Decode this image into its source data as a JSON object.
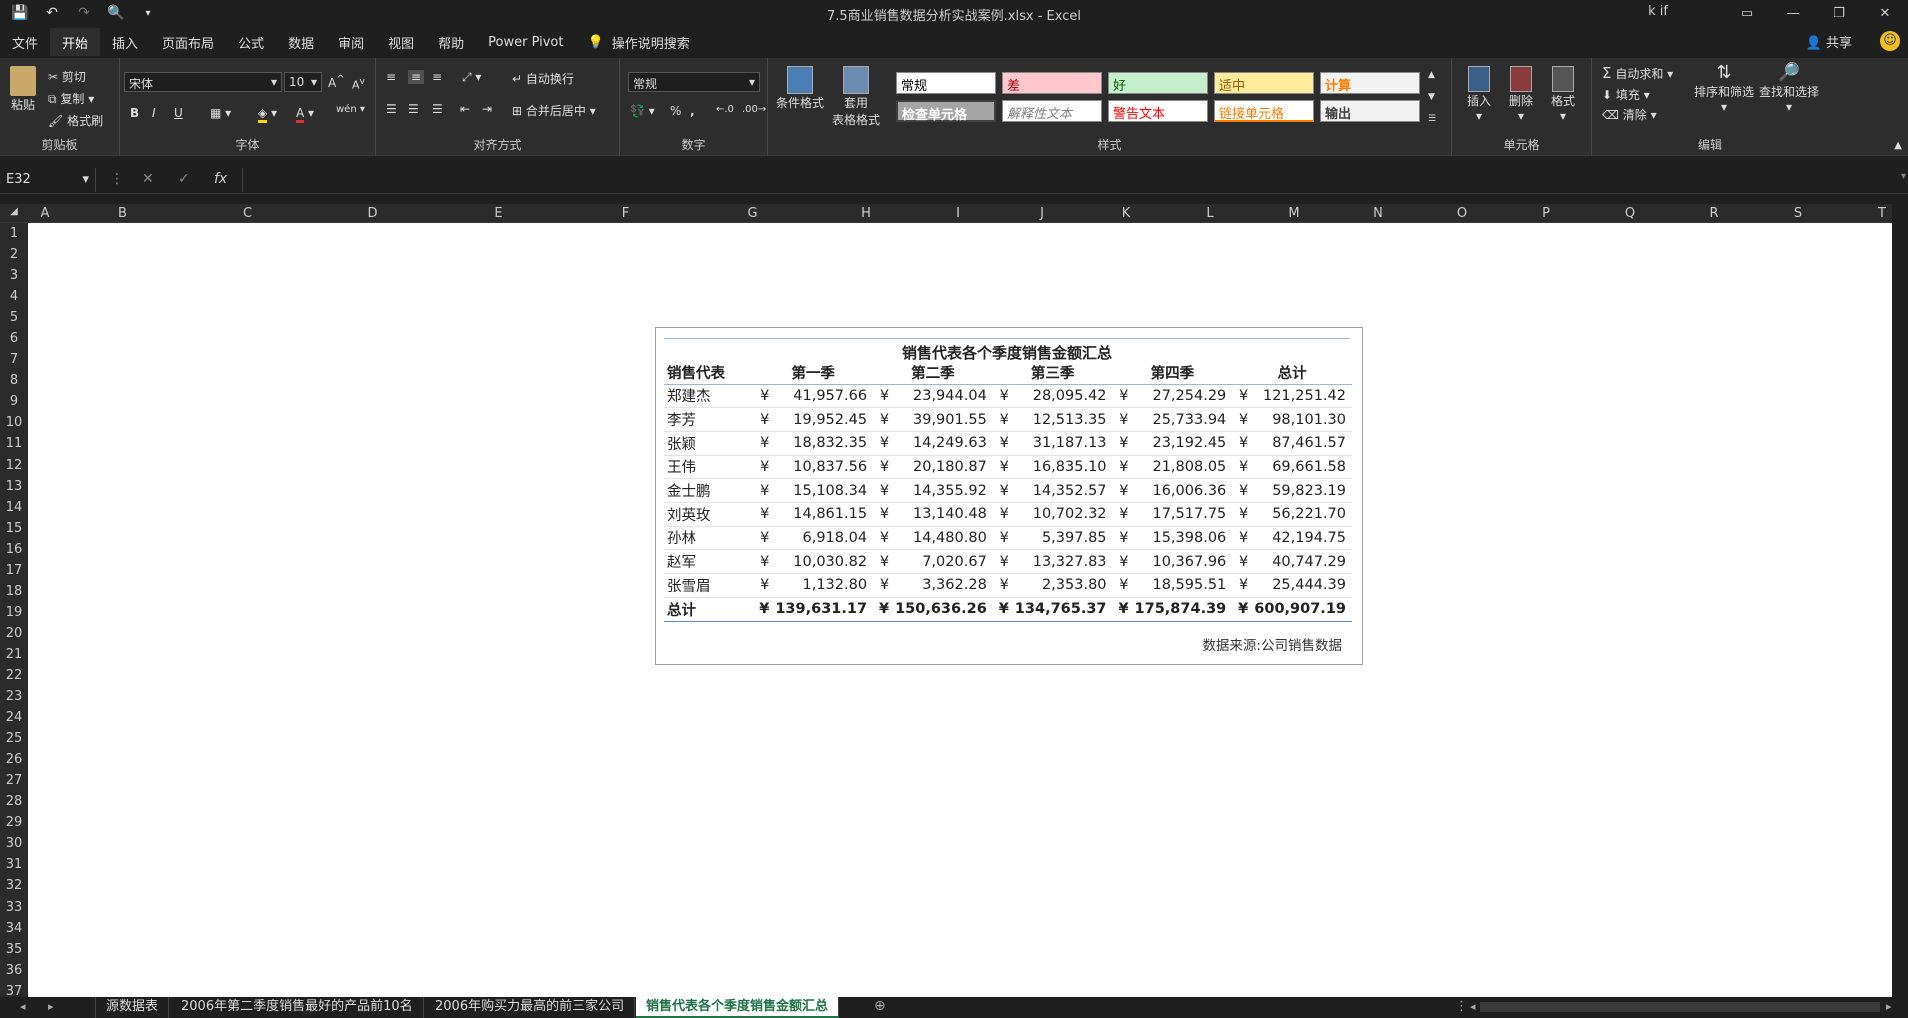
{
  "window": {
    "title": "7.5商业销售数据分析实战案例.xlsx  -  Excel",
    "user": "k if"
  },
  "menu": {
    "tabs": [
      "文件",
      "开始",
      "插入",
      "页面布局",
      "公式",
      "数据",
      "审阅",
      "视图",
      "帮助",
      "Power Pivot"
    ],
    "active": "开始",
    "tell_me": "操作说明搜索",
    "share": "共享"
  },
  "ribbon": {
    "clipboard": {
      "paste": "粘贴",
      "cut": "剪切",
      "copy": "复制",
      "format_painter": "格式刷",
      "label": "剪贴板"
    },
    "font": {
      "name": "宋体",
      "size": "10",
      "bold": "B",
      "italic": "I",
      "underline": "U",
      "label": "字体"
    },
    "alignment": {
      "wrap": "自动换行",
      "merge": "合并后居中",
      "label": "对齐方式"
    },
    "number": {
      "format": "常规",
      "percent": "%",
      "comma": ",",
      "label": "数字"
    },
    "styles": {
      "conditional": "条件格式",
      "table_format_1": "套用",
      "table_format_2": "表格格式",
      "cells": [
        {
          "text": "常规",
          "bg": "#ffffff",
          "color": "#000000"
        },
        {
          "text": "差",
          "bg": "#ffc7ce",
          "color": "#9c0006"
        },
        {
          "text": "好",
          "bg": "#c6efce",
          "color": "#006100"
        },
        {
          "text": "适中",
          "bg": "#ffeb9c",
          "color": "#9c5700"
        },
        {
          "text": "计算",
          "bg": "#f2f2f2",
          "color": "#fa7d00"
        },
        {
          "text": "检查单元格",
          "bg": "#a5a5a5",
          "color": "#ffffff"
        },
        {
          "text": "解释性文本",
          "bg": "#ffffff",
          "color": "#7f7f7f"
        },
        {
          "text": "警告文本",
          "bg": "#ffffff",
          "color": "#ff0000"
        },
        {
          "text": "链接单元格",
          "bg": "#ffffff",
          "color": "#fa7d00"
        },
        {
          "text": "输出",
          "bg": "#f2f2f2",
          "color": "#3f3f3f"
        }
      ],
      "label": "样式"
    },
    "cells": {
      "insert": "插入",
      "delete": "删除",
      "format": "格式",
      "label": "单元格"
    },
    "editing": {
      "autosum": "自动求和",
      "fill": "填充",
      "clear": "清除",
      "sort": "排序和筛选",
      "find": "查找和选择",
      "label": "编辑"
    }
  },
  "formula_bar": {
    "name_box": "E32",
    "formula": ""
  },
  "columns": [
    "A",
    "B",
    "C",
    "D",
    "E",
    "F",
    "G",
    "H",
    "I",
    "J",
    "K",
    "L",
    "M",
    "N",
    "O",
    "P",
    "Q",
    "R",
    "S",
    "T"
  ],
  "rows": [
    "1",
    "2",
    "3",
    "4",
    "5",
    "6",
    "7",
    "8",
    "9",
    "10",
    "11",
    "12",
    "13",
    "14",
    "15",
    "16",
    "17",
    "18",
    "19",
    "20",
    "21",
    "22",
    "23",
    "24",
    "25",
    "26",
    "27",
    "28",
    "29",
    "30",
    "31",
    "32",
    "33",
    "34",
    "35",
    "36",
    "37"
  ],
  "report": {
    "title": "销售代表各个季度销售金额汇总",
    "headers": [
      "销售代表",
      "第一季",
      "第二季",
      "第三季",
      "第四季",
      "总计"
    ],
    "currency": "¥",
    "rows": [
      {
        "name": "郑建杰",
        "q1": "41,957.66",
        "q2": "23,944.04",
        "q3": "28,095.42",
        "q4": "27,254.29",
        "total": "121,251.42"
      },
      {
        "name": "李芳",
        "q1": "19,952.45",
        "q2": "39,901.55",
        "q3": "12,513.35",
        "q4": "25,733.94",
        "total": "98,101.30"
      },
      {
        "name": "张颖",
        "q1": "18,832.35",
        "q2": "14,249.63",
        "q3": "31,187.13",
        "q4": "23,192.45",
        "total": "87,461.57"
      },
      {
        "name": "王伟",
        "q1": "10,837.56",
        "q2": "20,180.87",
        "q3": "16,835.10",
        "q4": "21,808.05",
        "total": "69,661.58"
      },
      {
        "name": "金士鹏",
        "q1": "15,108.34",
        "q2": "14,355.92",
        "q3": "14,352.57",
        "q4": "16,006.36",
        "total": "59,823.19"
      },
      {
        "name": "刘英玫",
        "q1": "14,861.15",
        "q2": "13,140.48",
        "q3": "10,702.32",
        "q4": "17,517.75",
        "total": "56,221.70"
      },
      {
        "name": "孙林",
        "q1": "6,918.04",
        "q2": "14,480.80",
        "q3": "5,397.85",
        "q4": "15,398.06",
        "total": "42,194.75"
      },
      {
        "name": "赵军",
        "q1": "10,030.82",
        "q2": "7,020.67",
        "q3": "13,327.83",
        "q4": "10,367.96",
        "total": "40,747.29"
      },
      {
        "name": "张雪眉",
        "q1": "1,132.80",
        "q2": "3,362.28",
        "q3": "2,353.80",
        "q4": "18,595.51",
        "total": "25,444.39"
      }
    ],
    "total_row": {
      "name": "总计",
      "q1": "139,631.17",
      "q2": "150,636.26",
      "q3": "134,765.37",
      "q4": "175,874.39",
      "total": "600,907.19"
    },
    "source": "数据来源:公司销售数据"
  },
  "sheet_tabs": [
    "源数据表",
    "2006年第二季度销售最好的产品前10名",
    "2006年购买力最高的前三家公司",
    "销售代表各个季度销售金额汇总"
  ],
  "active_sheet": "销售代表各个季度销售金额汇总"
}
